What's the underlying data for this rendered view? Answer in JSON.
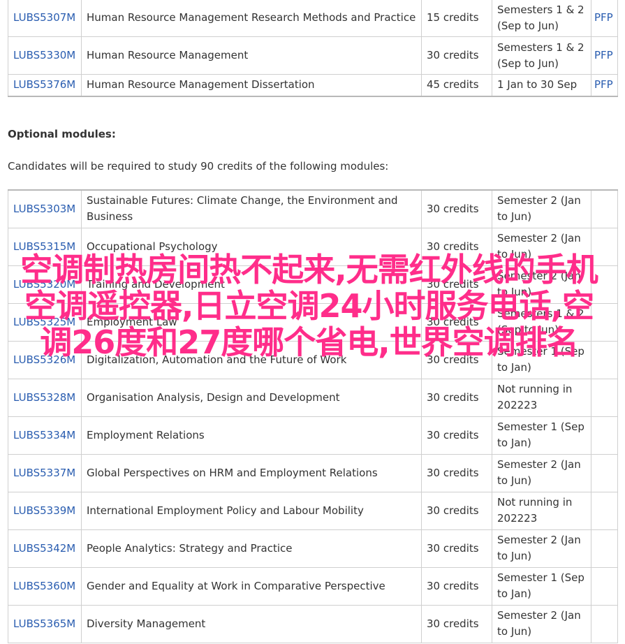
{
  "compulsory_modules": [
    {
      "code": "LUBS5307M",
      "title": "Human Resource Management Research Methods and Practice",
      "credits": "15 credits",
      "period": "Semesters 1 & 2 (Sep to Jun)",
      "spec": "PFP"
    },
    {
      "code": "LUBS5330M",
      "title": "Human Resource Management",
      "credits": "30 credits",
      "period": "Semesters 1 & 2 (Sep to Jun)",
      "spec": "PFP"
    },
    {
      "code": "LUBS5376M",
      "title": "Human Resource Management Dissertation",
      "credits": "45 credits",
      "period": "1 Jan to 30 Sep",
      "spec": "PFP"
    }
  ],
  "optional": {
    "heading": "Optional modules:",
    "intro": "Candidates will be required to study 90 credits of the following modules:"
  },
  "optional_modules": [
    {
      "code": "LUBS5303M",
      "title": "Sustainable Futures: Climate Change, the Environment and Business",
      "credits": "30 credits",
      "period": "Semester 2 (Jan to Jun)"
    },
    {
      "code": "LUBS5315M",
      "title": "Occupational Psychology",
      "credits": "30 credits",
      "period": "Semester 2 (Jan to Jun)"
    },
    {
      "code": "LUBS5320M",
      "title": "Training and Development",
      "credits": "30 credits",
      "period": "Semester 2 (Jan to Jun)"
    },
    {
      "code": "LUBS5325M",
      "title": "Employment Law",
      "credits": "30 credits",
      "period": "Semesters 1 & 2 (Sep to Jun)"
    },
    {
      "code": "LUBS5326M",
      "title": "Digitalization, Automation and the Future of Work",
      "credits": "30 credits",
      "period": "Semester 1 (Sep to Jan)"
    },
    {
      "code": "LUBS5328M",
      "title": "Organisation Analysis, Design and Development",
      "credits": "30 credits",
      "period": "Not running in 202223"
    },
    {
      "code": "LUBS5334M",
      "title": "Employment Relations",
      "credits": "30 credits",
      "period": "Semester 1 (Sep to Jan)"
    },
    {
      "code": "LUBS5337M",
      "title": "Global Perspectives on HRM and Employment Relations",
      "credits": "30 credits",
      "period": "Semester 2 (Jan to Jun)"
    },
    {
      "code": "LUBS5339M",
      "title": "International Employment Policy and Labour Mobility",
      "credits": "30 credits",
      "period": "Not running in 202223"
    },
    {
      "code": "LUBS5342M",
      "title": "People Analytics: Strategy and Practice",
      "credits": "30 credits",
      "period": "Semester 2 (Jan to Jun)"
    },
    {
      "code": "LUBS5360M",
      "title": "Gender and Equality at Work in Comparative Perspective",
      "credits": "30 credits",
      "period": "Semester 1 (Sep to Jan)"
    },
    {
      "code": "LUBS5365M",
      "title": "Diversity Management",
      "credits": "30 credits",
      "period": "Semester 2 (Jan to Jun)"
    }
  ],
  "overlay_text": "空调制热房间热不起来,无需红外线的手机空调遥控器,日立空调24小时服务电话,空调26度和27度哪个省电,世界空调排名",
  "colors": {
    "link": "#2a5db0",
    "text": "#333333",
    "border": "#cfcfcf",
    "overlay": "#ff2d8a"
  }
}
